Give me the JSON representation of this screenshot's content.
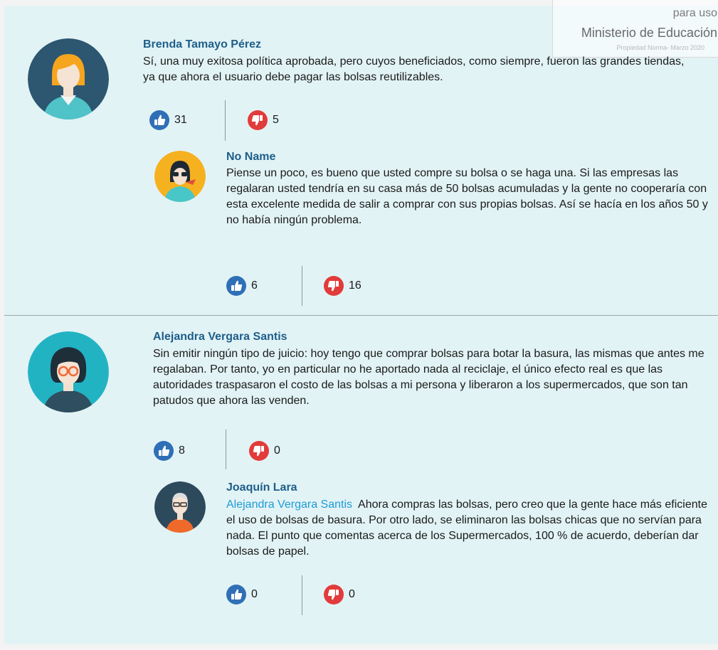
{
  "watermark": {
    "line1": "para uso",
    "line2": "Ministerio de Educación",
    "line3": "Propiedad Norma- Marzo 2020"
  },
  "comments": [
    {
      "author": "Brenda Tamayo Pérez",
      "text": "Sí, una muy exitosa política aprobada, pero cuyos beneficiados, como siempre, fueron las grandes tiendas, ya que ahora el usuario debe pagar las bolsas reutilizables.",
      "likes": "31",
      "dislikes": "5",
      "reply": {
        "author": "No Name",
        "text": "Piense un poco, es bueno que usted compre su bolsa o se haga una. Si las empresas las regalaran usted tendría en su casa más de 50 bolsas acumuladas y la gente no cooperaría con esta excelente medida de salir a comprar con sus propias bolsas. Así se hacía en los años 50 y no había ningún problema.",
        "likes": "6",
        "dislikes": "16"
      }
    },
    {
      "author": "Alejandra Vergara Santis",
      "text": "Sin emitir ningún tipo de juicio: hoy tengo que comprar bolsas para botar la basura, las mismas que antes me regalaban. Por tanto, yo en particular no he aportado nada al reciclaje, el único efecto real es que las autoridades traspasaron el costo de las bolsas a mi persona y liberaron a los supermercados, que son tan patudos que ahora las venden.",
      "likes": "8",
      "dislikes": "0",
      "reply": {
        "author": "Joaquín Lara",
        "mention": "Alejandra Vergara Santis",
        "text": "Ahora compras las bolsas, pero creo que la gente hace más eficiente el uso de bolsas de basura. Por otro lado, se eliminaron las bolsas chicas que no servían para nada. El punto que comentas acerca de los Supermercados, 100 % de acuerdo, deberían dar bolsas de papel.",
        "likes": "0",
        "dislikes": "0"
      }
    }
  ],
  "colors": {
    "panel": "#e2f3f5",
    "author": "#1d5e8a",
    "mention": "#1e9bd7",
    "like": "#2f6fb6",
    "dislike": "#e23b3b"
  },
  "icons": {
    "like": "thumbs-up-icon",
    "dislike": "thumbs-down-icon"
  }
}
